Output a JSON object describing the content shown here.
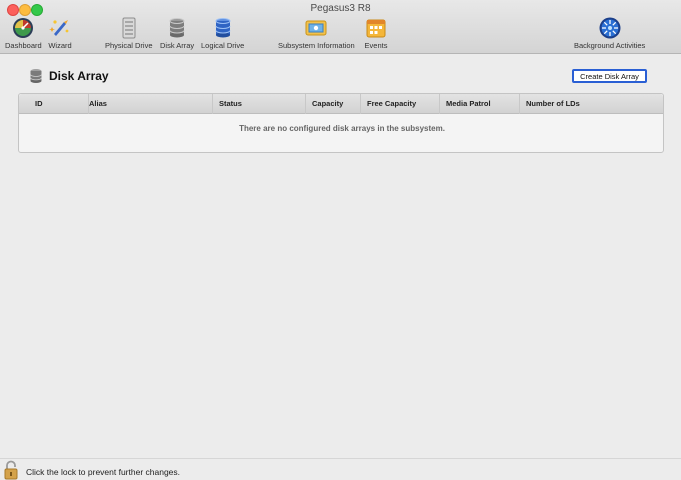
{
  "window": {
    "title": "Pegasus3 R8"
  },
  "toolbar": {
    "items": [
      {
        "label": "Dashboard",
        "icon": "dashboard-icon"
      },
      {
        "label": "Wizard",
        "icon": "wizard-icon"
      },
      {
        "label": "Physical Drive",
        "icon": "physical-drive-icon"
      },
      {
        "label": "Disk Array",
        "icon": "disk-array-icon"
      },
      {
        "label": "Logical Drive",
        "icon": "logical-drive-icon"
      },
      {
        "label": "Subsystem Information",
        "icon": "subsystem-information-icon"
      },
      {
        "label": "Events",
        "icon": "events-icon"
      },
      {
        "label": "Background Activities",
        "icon": "background-activities-icon"
      }
    ]
  },
  "page": {
    "title": "Disk Array",
    "create_button_label": "Create Disk Array"
  },
  "table": {
    "columns": [
      "ID",
      "Alias",
      "Status",
      "Capacity",
      "Free Capacity",
      "Media Patrol",
      "Number of LDs"
    ],
    "empty_message": "There are no configured disk arrays in the subsystem."
  },
  "footer": {
    "lock_text": "Click the lock to prevent further changes."
  },
  "colors": {
    "accent_button_border": "#2a5fd4",
    "close": "#fc605c",
    "minimize": "#fdbc40",
    "maximize": "#34c84a"
  }
}
